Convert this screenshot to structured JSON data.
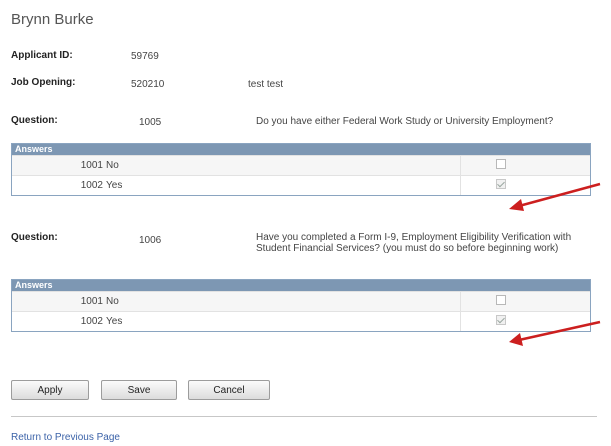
{
  "applicant": {
    "name": "Brynn Burke",
    "id_label": "Applicant ID:",
    "id_value": "59769",
    "job_label": "Job Opening:",
    "job_value": "520210",
    "job_title": "test test"
  },
  "questions": [
    {
      "label": "Question:",
      "number": "1005",
      "text": "Do you have either Federal Work Study or University Employment?",
      "answers_header": "Answers",
      "answers": [
        {
          "number": "1001",
          "text": "No",
          "checked": false
        },
        {
          "number": "1002",
          "text": "Yes",
          "checked": true
        }
      ]
    },
    {
      "label": "Question:",
      "number": "1006",
      "text": "Have you completed a Form I-9, Employment Eligibility Verification with Student Financial Services? (you must do so before beginning work)",
      "answers_header": "Answers",
      "answers": [
        {
          "number": "1001",
          "text": "No",
          "checked": false
        },
        {
          "number": "1002",
          "text": "Yes",
          "checked": true
        }
      ]
    }
  ],
  "buttons": {
    "apply": "Apply",
    "save": "Save",
    "cancel": "Cancel"
  },
  "return_link": "Return to Previous Page",
  "colors": {
    "grid_header": "#7d97b3",
    "annotation_arrow": "#cc1f1f",
    "link": "#3b62a8"
  }
}
